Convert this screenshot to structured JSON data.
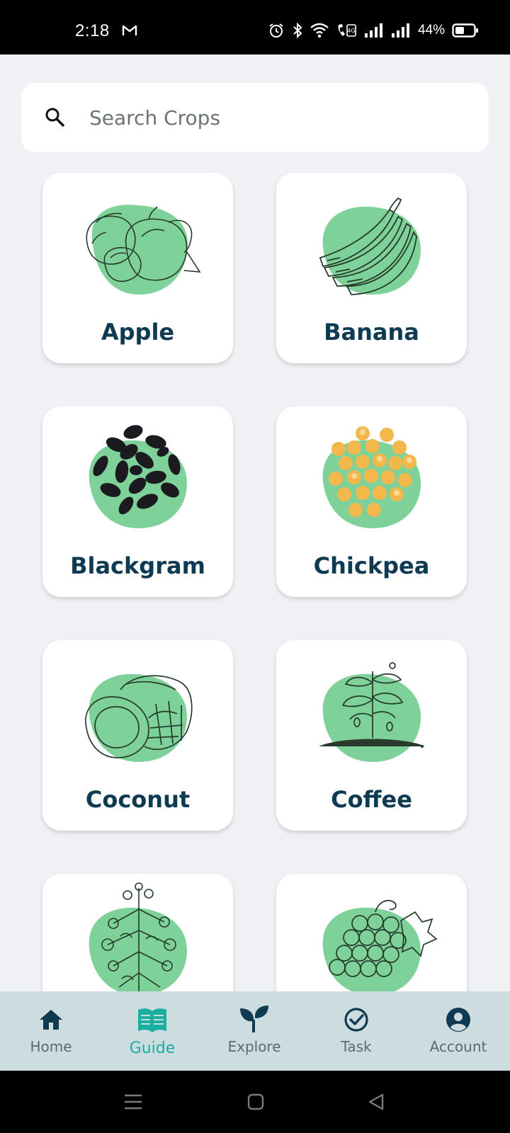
{
  "status_bar": {
    "time": "2:18",
    "battery_percent": "44%",
    "icons": [
      "gmail-icon",
      "alarm-icon",
      "bluetooth-icon",
      "wifi-icon",
      "volte-icon",
      "signal-1-icon",
      "signal-2-icon",
      "battery-icon"
    ]
  },
  "search": {
    "placeholder": "Search Crops",
    "value": ""
  },
  "crops": [
    {
      "name": "Apple",
      "icon": "apple-illustration"
    },
    {
      "name": "Banana",
      "icon": "banana-illustration"
    },
    {
      "name": "Blackgram",
      "icon": "blackgram-illustration"
    },
    {
      "name": "Chickpea",
      "icon": "chickpea-illustration"
    },
    {
      "name": "Coconut",
      "icon": "coconut-illustration"
    },
    {
      "name": "Coffee",
      "icon": "coffee-illustration"
    },
    {
      "name": "",
      "icon": "cotton-plant-illustration"
    },
    {
      "name": "",
      "icon": "grapes-illustration"
    }
  ],
  "bottom_nav": {
    "active": "Guide",
    "items": [
      {
        "label": "Home",
        "icon": "home-icon"
      },
      {
        "label": "Guide",
        "icon": "book-icon"
      },
      {
        "label": "Explore",
        "icon": "sprout-icon"
      },
      {
        "label": "Task",
        "icon": "check-circle-icon"
      },
      {
        "label": "Account",
        "icon": "account-circle-icon"
      }
    ]
  },
  "colors": {
    "background": "#eff1f4",
    "card": "#ffffff",
    "crop_blob": "#7fd19a",
    "title": "#0e3a52",
    "nav_background": "#ccdcdf",
    "nav_active": "#1aaea0",
    "nav_inactive": "#0e3a52"
  }
}
